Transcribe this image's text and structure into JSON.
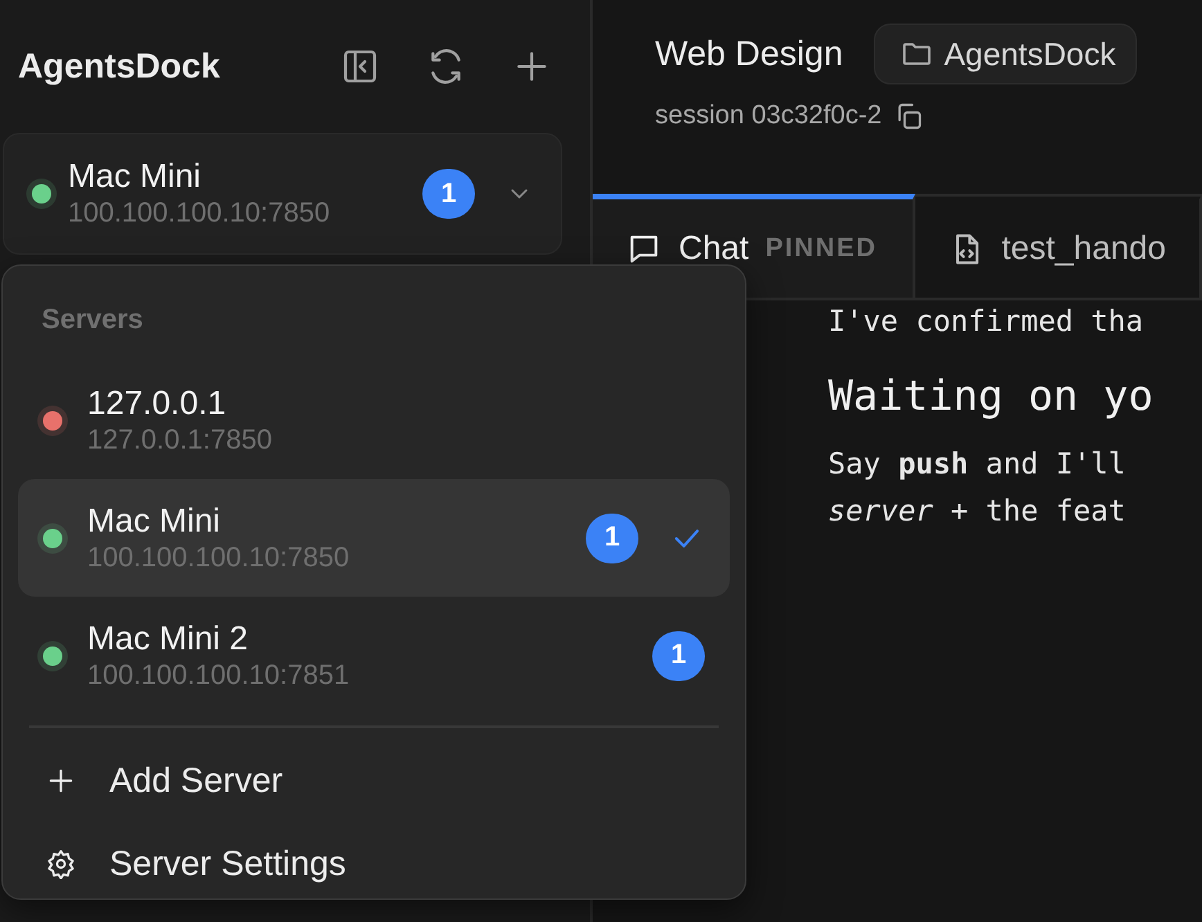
{
  "sidebar": {
    "title": "AgentsDock",
    "current_server": {
      "name": "Mac Mini",
      "address": "100.100.100.10:7850",
      "color": "#6ad08b",
      "badge": "1"
    }
  },
  "header": {
    "title": "Web Design",
    "project": "AgentsDock",
    "session": "session 03c32f0c-2"
  },
  "tabs": [
    {
      "label": "Chat",
      "tag": "PINNED",
      "kind": "chat",
      "selected": true
    },
    {
      "label": "test_hando",
      "kind": "file",
      "selected": false
    }
  ],
  "messages": [
    {
      "kind": "text",
      "text": "I've confirmed tha"
    },
    {
      "kind": "heading",
      "text": "Waiting on yo"
    },
    {
      "kind": "text",
      "text": "Say **push** and I'll"
    },
    {
      "kind": "text",
      "text": "*server* + the feat"
    }
  ],
  "server_menu": {
    "heading": "Servers",
    "servers": [
      {
        "name": "127.0.0.1",
        "address": "127.0.0.1:7850",
        "color": "#e8716b",
        "selected": false
      },
      {
        "name": "Mac Mini",
        "address": "100.100.100.10:7850",
        "color": "#6ad08b",
        "badge": "1",
        "selected": true
      },
      {
        "name": "Mac Mini 2",
        "address": "100.100.100.10:7851",
        "color": "#6ad08b",
        "badge": "1",
        "selected": false
      }
    ],
    "actions": [
      {
        "label": "Add Server",
        "kind": "add"
      },
      {
        "label": "Server Settings",
        "kind": "settings"
      }
    ]
  }
}
